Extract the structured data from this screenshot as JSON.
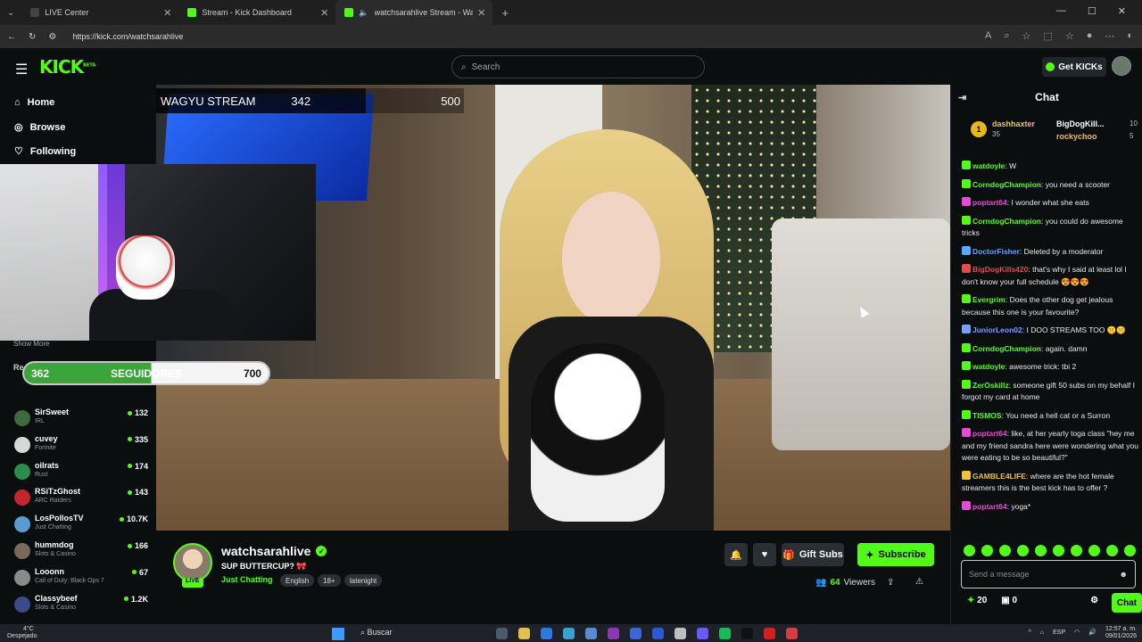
{
  "browser": {
    "tabs": [
      {
        "label": "LIVE Center",
        "active": false
      },
      {
        "label": "Stream - Kick Dashboard",
        "active": false
      },
      {
        "label": "watchsarahlive Stream - Watc",
        "active": true
      }
    ],
    "url": "https://kick.com/watchsarahlive"
  },
  "header": {
    "logo": "KICK",
    "logo_beta": "BETA",
    "search_placeholder": "Search",
    "get_kicks": "Get KICKs"
  },
  "sidebar": {
    "nav": [
      {
        "label": "Home",
        "icon": "home-icon"
      },
      {
        "label": "Browse",
        "icon": "compass-icon"
      },
      {
        "label": "Following",
        "icon": "heart-icon"
      }
    ],
    "show_more": "Show More",
    "recommended_label": "Re",
    "channels": [
      {
        "name": "SirSweet",
        "category": "IRL",
        "viewers": "132",
        "color": "#3d6b3d"
      },
      {
        "name": "cuvey",
        "category": "Fortnite",
        "viewers": "335",
        "color": "#d8d8d8"
      },
      {
        "name": "oilrats",
        "category": "Rust",
        "viewers": "174",
        "color": "#2a8f4a"
      },
      {
        "name": "RSiTzGhost",
        "category": "ARC Raiders",
        "viewers": "143",
        "color": "#c4242b"
      },
      {
        "name": "LosPollosTV",
        "category": "Just Chatting",
        "viewers": "10.7K",
        "color": "#5a9bd4"
      },
      {
        "name": "hummdog",
        "category": "Slots & Casino",
        "viewers": "166",
        "color": "#7a6a5a"
      },
      {
        "name": "Looonn",
        "category": "Call of Duty: Black Ops 7",
        "viewers": "67",
        "color": "#8a8a8a"
      },
      {
        "name": "Classybeef",
        "category": "Slots & Casino",
        "viewers": "1.2K",
        "color": "#3a4a8a"
      }
    ]
  },
  "follow_goal": {
    "current": "362",
    "label": "SEGUIDORES",
    "target": "700",
    "progress": 0.52
  },
  "stream_overlay": {
    "title": "WAGYU STREAM",
    "current": "342",
    "target": "500"
  },
  "channel": {
    "name": "watchsarahlive",
    "live_badge": "LIVE",
    "title": "SUP BUTTERCUP? 🎀",
    "category": "Just Chatting",
    "tags": [
      "English",
      "18+",
      "latenight"
    ],
    "gift_label": "Gift Subs",
    "subscribe_label": "Subscribe",
    "viewers": "64",
    "viewers_label": "Viewers"
  },
  "chat": {
    "title": "Chat",
    "pinned": [
      {
        "rank": "1",
        "name": "dashhaxter",
        "count": "35"
      },
      {
        "name": "BigDogKill...",
        "count": "10"
      },
      {
        "name": "rockychoo",
        "count": "5"
      }
    ],
    "messages": [
      {
        "user": "watdoyle",
        "text": "W",
        "color": "#53fc18"
      },
      {
        "user": "CorndogChampion",
        "text": "you need a scooter",
        "color": "#53fc18"
      },
      {
        "user": "poptart64",
        "text": "I wonder what she eats",
        "color": "#e64bd4"
      },
      {
        "user": "CorndogChampion",
        "text": "you could do awesome tricks",
        "color": "#53fc18"
      },
      {
        "user": "DoctorFisher",
        "text": "Deleted by a moderator",
        "color": "#5aa9ff"
      },
      {
        "user": "BigDogKills420",
        "text": "that's why I said at least lol I don't know your full schedule 😍😍😍",
        "color": "#e64b4b"
      },
      {
        "user": "Evergrim",
        "text": "Does the other dog get jealous because this one is your favourite?",
        "color": "#53fc18"
      },
      {
        "user": "JuniorLeon02",
        "text": "I DOO STREAMS TOO 🤫🤫",
        "color": "#7aa0ff"
      },
      {
        "user": "CorndogChampion",
        "text": "again. damn",
        "color": "#53fc18"
      },
      {
        "user": "watdoyle",
        "text": "awesome trick: tbi 2",
        "color": "#53fc18"
      },
      {
        "user": "ZerOskillz",
        "text": "someone gift 50 subs on my behalf I forgot my card at home",
        "color": "#53fc18"
      },
      {
        "user": "TISMOS",
        "text": "You need a hell cat or a Surron",
        "color": "#53fc18"
      },
      {
        "user": "poptart64",
        "text": "like, at her yearly toga class \"hey me and my friend sandra here were wondering what you were eating to be so beautiful?\"",
        "color": "#e64bd4"
      },
      {
        "user": "GAMBLE4LIFE",
        "text": "where are the hot female streamers this is the best kick has to offer ?",
        "color": "#f0c040"
      },
      {
        "user": "poptart64",
        "text": "yoga*",
        "color": "#e64bd4"
      }
    ],
    "input_placeholder": "Send a message",
    "kicks_count": "20",
    "points_count": "0",
    "send_label": "Chat"
  },
  "taskbar": {
    "temp": "4°C",
    "weather": "Despejado",
    "search": "Buscar",
    "lang": "ESP",
    "time": "12:57 a. m.",
    "date": "09/01/2026"
  }
}
